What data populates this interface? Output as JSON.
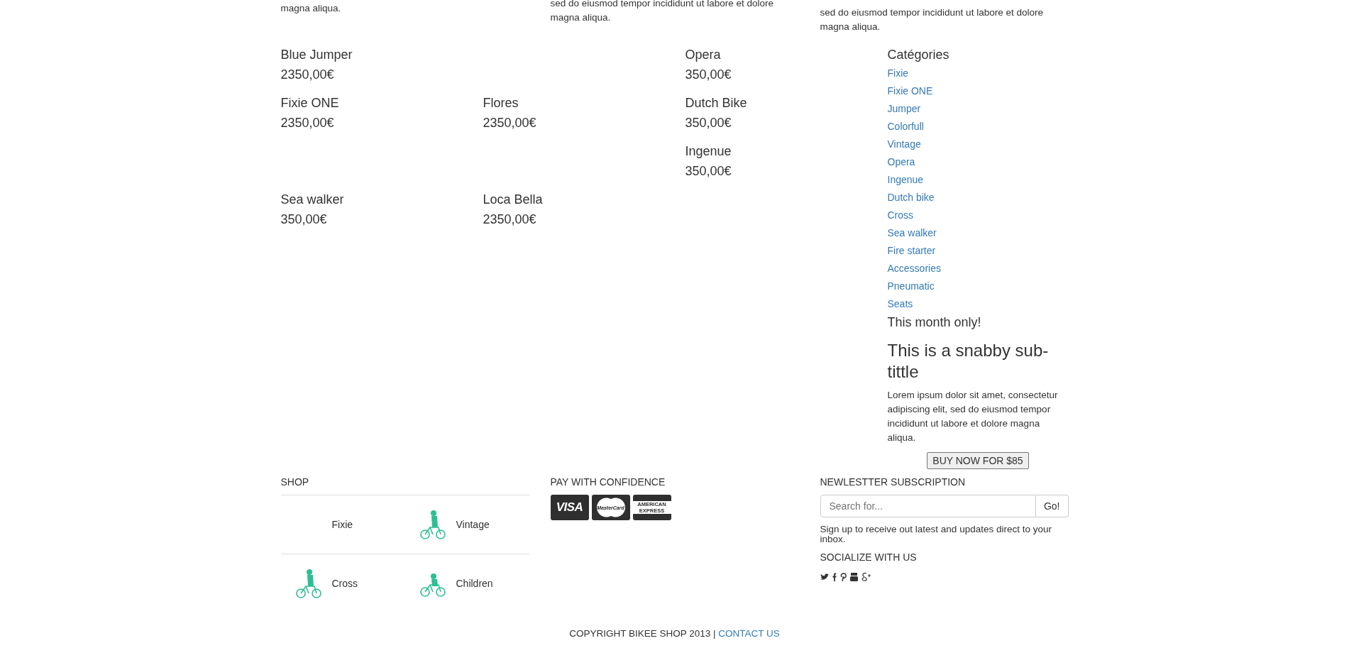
{
  "intro_columns": [
    [
      "magna aliqua."
    ],
    [
      "sed do eiusmod tempor incididunt ut labore et dolore",
      "magna aliqua."
    ],
    [
      "sed do eiusmod tempor incididunt ut labore et dolore",
      "magna aliqua."
    ]
  ],
  "product_rows": [
    [
      {
        "name": "Blue Jumper",
        "price": "2350,00€"
      },
      null,
      {
        "name": "Opera",
        "price": "350,00€"
      }
    ],
    [
      {
        "name": "Fixie ONE",
        "price": "2350,00€"
      },
      {
        "name": "Flores",
        "price": "2350,00€"
      },
      {
        "name": "Dutch Bike",
        "price": "350,00€"
      }
    ],
    [
      null,
      null,
      {
        "name": "Ingenue",
        "price": "350,00€"
      }
    ],
    [
      {
        "name": "Sea walker",
        "price": "350,00€"
      },
      {
        "name": "Loca Bella",
        "price": "2350,00€"
      }
    ]
  ],
  "sidebar": {
    "title": "Catégories",
    "categories": [
      "Fixie",
      "Fixie ONE",
      "Jumper",
      "Colorfull",
      "Vintage",
      "Opera",
      "Ingenue",
      "Dutch bike",
      "Cross",
      "Sea walker",
      "Fire starter",
      "Accessories",
      "Pneumatic",
      "Seats"
    ],
    "promo_label": "This month only!",
    "promo_title": "This is a snabby sub-tittle",
    "promo_text": "Lorem ipsum dolor sit amet, consectetur adipiscing elit, sed do eiusmod tempor incididunt ut labore et dolore magna aliqua.",
    "promo_button": "BUY NOW FOR $85"
  },
  "footer": {
    "shop": {
      "title": "SHOP",
      "items": [
        {
          "label": "Fixie",
          "pictured": false
        },
        {
          "label": "Vintage",
          "pictured": true
        },
        {
          "label": "Cross",
          "pictured": true
        },
        {
          "label": "Children",
          "pictured": true
        }
      ]
    },
    "payment": {
      "title": "PAY WITH CONFIDENCE",
      "cards": [
        {
          "kind": "visa",
          "text": "VISA"
        },
        {
          "kind": "mastercard",
          "text": "MasterCard"
        },
        {
          "kind": "amex",
          "text": "AMERICAN EXPRESS"
        }
      ]
    },
    "newsletter": {
      "title": "NEWLESTTER SUBSCRIPTION",
      "placeholder": "Search for...",
      "button": "Go!",
      "text": "Sign up to receive out latest and updates direct to your inbox.",
      "social_title": "SOCIALIZE WITH US",
      "social": [
        {
          "kind": "twitter"
        },
        {
          "kind": "facebook"
        },
        {
          "kind": "pinterest"
        },
        {
          "kind": "youtube"
        },
        {
          "kind": "googleplus"
        }
      ]
    }
  },
  "copyright": {
    "text": "COPYRIGHT BIKEE SHOP 2013 |",
    "link": "CONTACT US"
  }
}
